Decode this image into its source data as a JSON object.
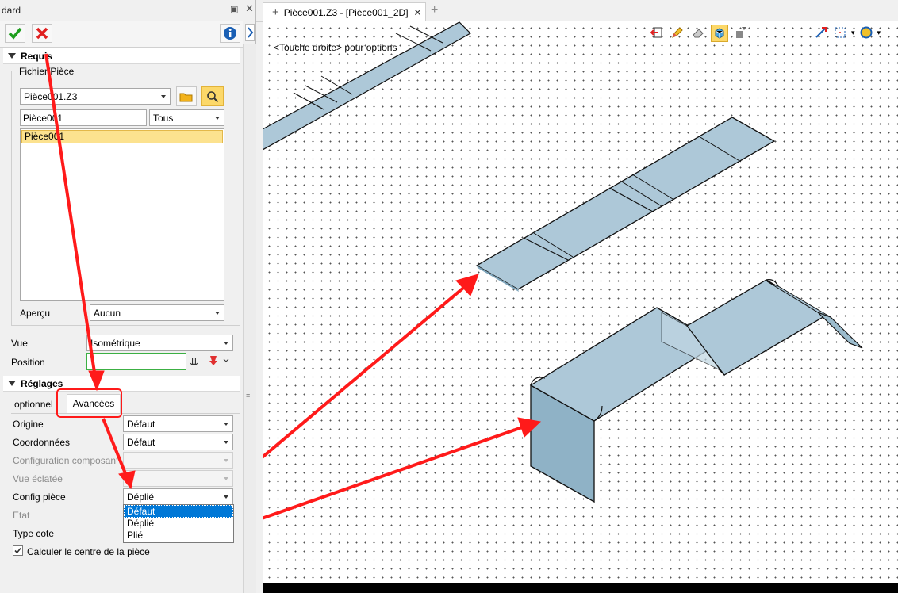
{
  "panel": {
    "title": "dard",
    "pin_icon": "pin-icon",
    "close_icon": "close-icon"
  },
  "toolbar": {
    "ok_icon": "check-icon",
    "cancel_icon": "cross-icon",
    "info_icon": "info-icon"
  },
  "requis": {
    "header": "Requis",
    "group_label": "Fichier/Pièce",
    "file_combo": "Pièce001.Z3",
    "name_filter": "Pièce001",
    "type_filter": "Tous",
    "list_items": [
      "Pièce001"
    ],
    "apercu_label": "Aperçu",
    "apercu_value": "Aucun",
    "vue_label": "Vue",
    "vue_value": "Isométrique",
    "position_label": "Position",
    "position_value": ""
  },
  "reglages": {
    "header": "Réglages",
    "tabs": [
      "optionnel",
      "Avancées"
    ],
    "active_tab": "Avancées",
    "rows": {
      "origine_label": "Origine",
      "origine_value": "Défaut",
      "coord_label": "Coordonnées",
      "coord_value": "Défaut",
      "config_comp_label": "Configuration composant",
      "vue_eclatee_label": "Vue éclatée",
      "config_piece_label": "Config pièce",
      "config_piece_value": "Déplié",
      "etat_label": "Etat",
      "type_cote_label": "Type cote"
    },
    "dropdown_options": [
      "Défaut",
      "Déplié",
      "Plié"
    ],
    "dropdown_selected": "Défaut",
    "checkbox_label": "Calculer le centre de la pièce",
    "checkbox_checked": true
  },
  "document": {
    "tab_title": "Pièce001.Z3 - [Pièce001_2D]",
    "hint": "<Touche droite> pour options"
  },
  "colors": {
    "accent": "#0078d7",
    "selection": "#fce28f",
    "sheet_fill": "#adc8d8",
    "sheet_edge": "#111111",
    "annotation": "#ff0000",
    "position_border": "#3cb043"
  }
}
